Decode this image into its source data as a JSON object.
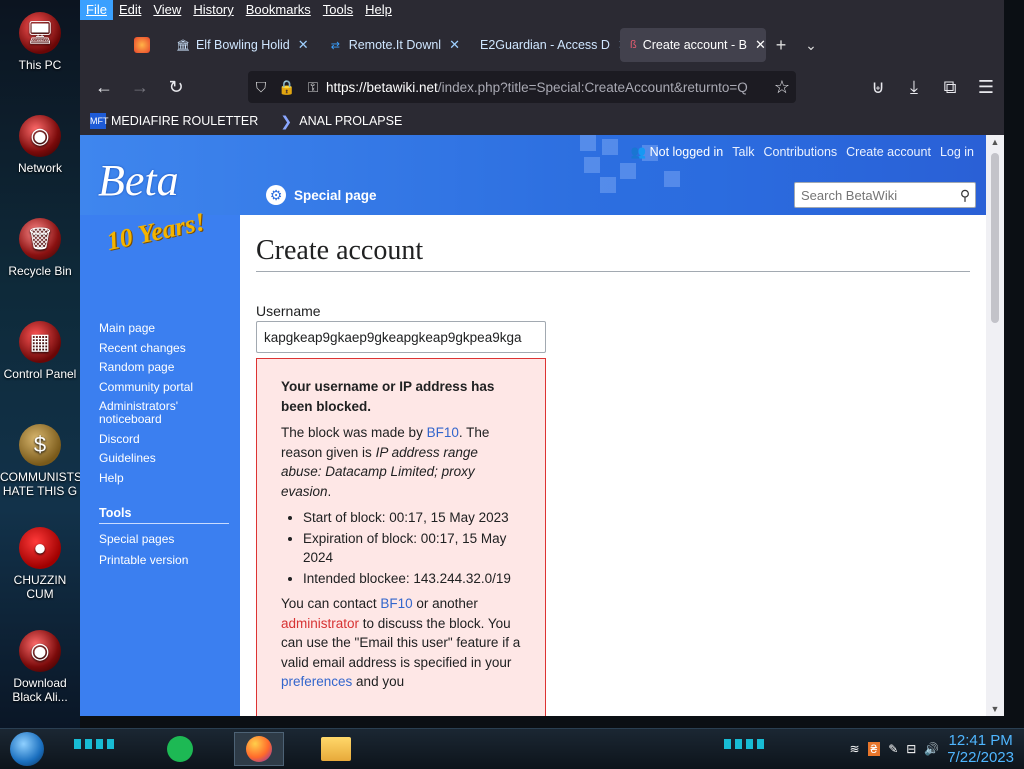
{
  "desktop": {
    "icons": [
      {
        "label": "This PC",
        "icon": "pc-icon"
      },
      {
        "label": "Network",
        "icon": "network-icon"
      },
      {
        "label": "Recycle Bin",
        "icon": "recycle-bin-icon"
      },
      {
        "label": "Control Panel",
        "icon": "control-panel-icon"
      },
      {
        "label": "COMMUNISTS HATE THIS G",
        "icon": "money-bag-icon"
      },
      {
        "label": "CHUZZIN CUM",
        "icon": "chuzzle-icon"
      },
      {
        "label": "Download Black Ali...",
        "icon": "download-icon"
      }
    ]
  },
  "browser": {
    "menu": [
      "File",
      "Edit",
      "View",
      "History",
      "Bookmarks",
      "Tools",
      "Help"
    ],
    "tabs": [
      {
        "label": "",
        "icon": "firefox-icon"
      },
      {
        "label": "Elf Bowling Holid",
        "icon": "bank-icon"
      },
      {
        "label": "Remote.It Downl",
        "icon": "remoteit-icon"
      },
      {
        "label": "E2Guardian - Access D",
        "icon": "e2guardian-icon"
      },
      {
        "label": "Create account - B",
        "icon": "betawiki-icon"
      }
    ],
    "url": {
      "host": "https://betawiki.net",
      "path": "/index.php?title=Special:CreateAccount&returnto=Q"
    },
    "bookmarks": [
      {
        "label": "MEDIAFIRE ROULETTER",
        "icon": "mediafire-icon"
      },
      {
        "label": "ANAL PROLAPSE",
        "icon": "bookmark-arrow-icon"
      }
    ]
  },
  "wiki": {
    "logo_text": "Beta",
    "logo_sub": "10 Years!",
    "personal": {
      "status": "Not logged in",
      "links": [
        "Talk",
        "Contributions",
        "Create account",
        "Log in"
      ]
    },
    "special_tab": "Special page",
    "search_placeholder": "Search BetaWiki",
    "nav": [
      "Main page",
      "Recent changes",
      "Random page",
      "Community portal",
      "Administrators' noticeboard",
      "Discord",
      "Guidelines",
      "Help"
    ],
    "tools_heading": "Tools",
    "tools": [
      "Special pages",
      "Printable version"
    ],
    "title": "Create account",
    "username_label": "Username",
    "username_value": "kapgkeap9gkaep9gkeapgkeap9gkpea9kga",
    "error": {
      "heading": "Your username or IP address has been blocked.",
      "p1_a": "The block was made by ",
      "p1_link": "BF10",
      "p1_b": ". The reason given is ",
      "p1_reason": "IP address range abuse: Datacamp Limited; proxy evasion",
      "p1_c": ".",
      "items": [
        "Start of block: 00:17, 15 May 2023",
        "Expiration of block: 00:17, 15 May 2024",
        "Intended blockee: 143.244.32.0/19"
      ],
      "p2_a": "You can contact ",
      "p2_link1": "BF10",
      "p2_b": " or another ",
      "p2_link2": "administrator",
      "p2_c": " to discuss the block. You can use the \"Email this user\" feature if a valid email address is specified in your ",
      "p2_link3": "preferences",
      "p2_d": " and you"
    }
  },
  "taskbar": {
    "time": "12:41 PM",
    "date": "7/22/2023"
  }
}
